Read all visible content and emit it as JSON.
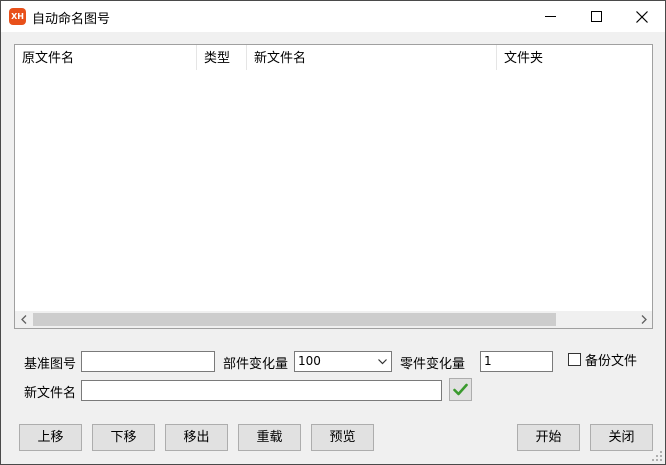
{
  "window": {
    "icon_text": "XH",
    "title": "自动命名图号"
  },
  "list": {
    "columns": [
      "原文件名",
      "类型",
      "新文件名",
      "文件夹"
    ]
  },
  "form": {
    "base_drawing_label": "基准图号",
    "base_drawing_value": "",
    "part_change_label": "部件变化量",
    "part_change_value": "100",
    "component_change_label": "零件变化量",
    "component_change_value": "1",
    "backup_label": "备份文件",
    "backup_checked": false,
    "new_filename_label": "新文件名",
    "new_filename_value": ""
  },
  "buttons": {
    "move_up": "上移",
    "move_down": "下移",
    "remove": "移出",
    "reload": "重载",
    "preview": "预览",
    "start": "开始",
    "close": "关闭"
  }
}
